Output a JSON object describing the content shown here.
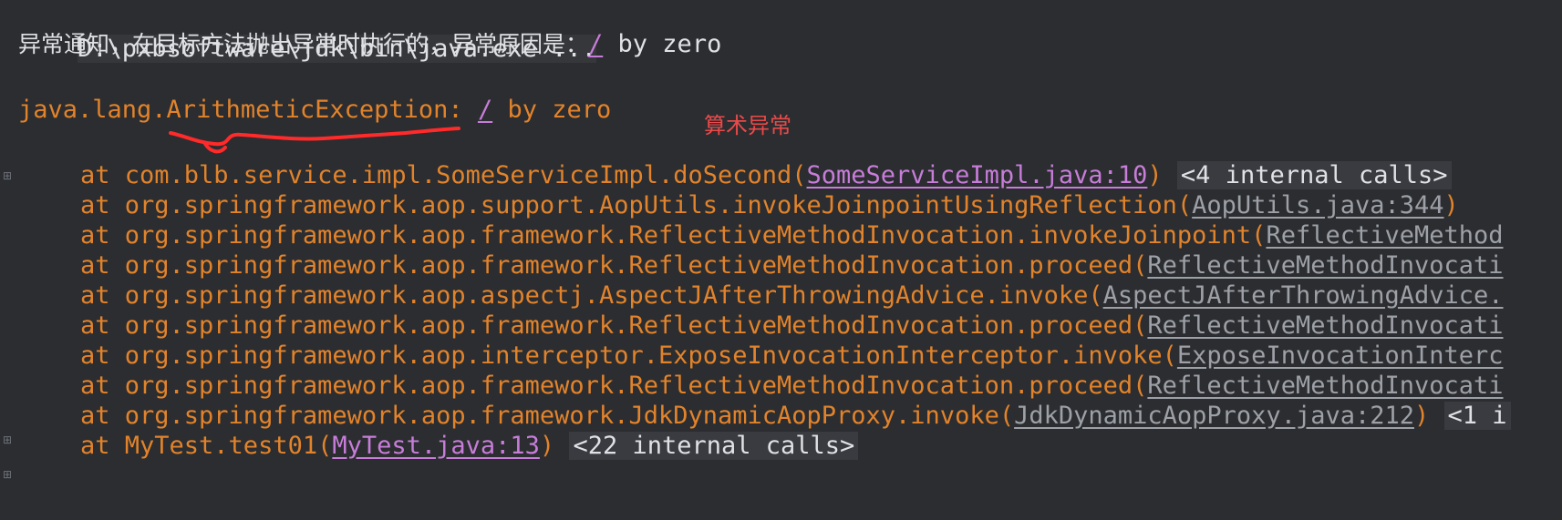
{
  "console": {
    "command_line": "D:\\pxbsoftware\\jdk\\bin\\java.exe ...",
    "notice_text": "异常通知，在目标方法抛出异常时执行的，异常原因是：",
    "notice_slash": "/",
    "notice_tail": " by zero",
    "exception_class": "java.lang.ArithmeticException:",
    "exception_slash": "/",
    "exception_tail": " by zero",
    "annotation": "算术异常",
    "stack_trace": [
      {
        "prefix": "at com.blb.service.impl.SomeServiceImpl.doSecond(",
        "link": "SomeServiceImpl.java:10",
        "suffix": ")",
        "hint": "<4 internal calls>",
        "link_style": "purple"
      },
      {
        "prefix": "at org.springframework.aop.support.AopUtils.invokeJoinpointUsingReflection(",
        "link": "AopUtils.java:344",
        "suffix": ")",
        "hint": "",
        "link_style": "gray"
      },
      {
        "prefix": "at org.springframework.aop.framework.ReflectiveMethodInvocation.invokeJoinpoint(",
        "link": "ReflectiveMethod",
        "suffix": "",
        "hint": "",
        "link_style": "gray"
      },
      {
        "prefix": "at org.springframework.aop.framework.ReflectiveMethodInvocation.proceed(",
        "link": "ReflectiveMethodInvocati",
        "suffix": "",
        "hint": "",
        "link_style": "gray"
      },
      {
        "prefix": "at org.springframework.aop.aspectj.AspectJAfterThrowingAdvice.invoke(",
        "link": "AspectJAfterThrowingAdvice.",
        "suffix": "",
        "hint": "",
        "link_style": "gray"
      },
      {
        "prefix": "at org.springframework.aop.framework.ReflectiveMethodInvocation.proceed(",
        "link": "ReflectiveMethodInvocati",
        "suffix": "",
        "hint": "",
        "link_style": "gray"
      },
      {
        "prefix": "at org.springframework.aop.interceptor.ExposeInvocationInterceptor.invoke(",
        "link": "ExposeInvocationInterc",
        "suffix": "",
        "hint": "",
        "link_style": "gray"
      },
      {
        "prefix": "at org.springframework.aop.framework.ReflectiveMethodInvocation.proceed(",
        "link": "ReflectiveMethodInvocati",
        "suffix": "",
        "hint": "",
        "link_style": "gray"
      },
      {
        "prefix": "at org.springframework.aop.framework.JdkDynamicAopProxy.invoke(",
        "link": "JdkDynamicAopProxy.java:212",
        "suffix": ")",
        "hint": "<1 i",
        "link_style": "gray"
      },
      {
        "prefix": "at MyTest.test01(",
        "link": "MyTest.java:13",
        "suffix": ")",
        "hint": "<22 internal calls>",
        "link_style": "purple"
      }
    ],
    "fold_icon": "fold-marker-icon",
    "colors": {
      "background": "#2b2d30",
      "stack_text": "#e2832b",
      "link_purple": "#c77dd9",
      "link_gray": "#9da0a6",
      "annotation_red": "#e84a4a"
    }
  }
}
